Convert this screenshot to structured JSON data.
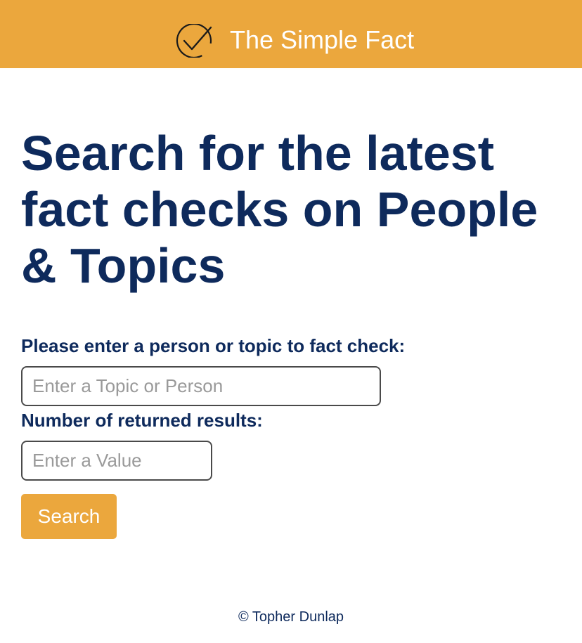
{
  "header": {
    "brand": "The Simple Fact",
    "logo_icon": "checkmark-circle-icon",
    "background_color": "#EBA73D"
  },
  "main": {
    "title": "Search for the latest fact checks on People & Topics",
    "topic_label": "Please enter a person or topic to fact check:",
    "topic_placeholder": "Enter a Topic or Person",
    "topic_value": "",
    "count_label": "Number of returned results:",
    "count_placeholder": "Enter a Value",
    "count_value": "",
    "search_label": "Search",
    "title_color": "#0E2A5C",
    "accent_color": "#EBA73D"
  },
  "footer": {
    "copyright": "© Topher Dunlap"
  }
}
